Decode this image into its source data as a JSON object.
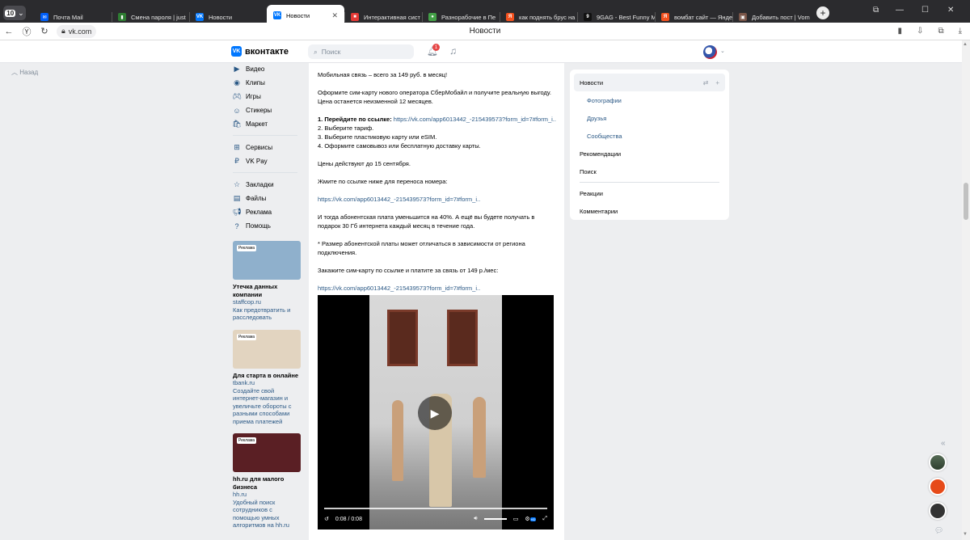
{
  "browser": {
    "tab_count": "10",
    "tabs": [
      {
        "label": "Почта Mail",
        "color": "#005ff9",
        "glyph": "✉"
      },
      {
        "label": "Смена пароля | just",
        "color": "#2e7d32",
        "glyph": "▮"
      },
      {
        "label": "Новости",
        "color": "#0077ff",
        "glyph": "VK"
      },
      {
        "label": "Новости",
        "color": "#0077ff",
        "glyph": "VK",
        "active": true
      },
      {
        "label": "Интерактивная сист",
        "color": "#e53935",
        "glyph": "■"
      },
      {
        "label": "Разнорабочие в Пе",
        "color": "#43a047",
        "glyph": "●"
      },
      {
        "label": "как поднять брус на",
        "color": "#f4511e",
        "glyph": "Я"
      },
      {
        "label": "9GAG - Best Funny M",
        "color": "#111111",
        "glyph": "9"
      },
      {
        "label": "вомбат сайт — Янде",
        "color": "#f4511e",
        "glyph": "Я"
      },
      {
        "label": "Добавить пост | Vom",
        "color": "#795548",
        "glyph": "▣"
      }
    ],
    "url": "vk.com",
    "page_title": "Новости"
  },
  "vk": {
    "brand": "вконтакте",
    "search_placeholder": "Поиск",
    "notif_count": "1",
    "back": "Назад"
  },
  "left_menu": {
    "group1": [
      "Видео",
      "Клипы",
      "Игры",
      "Стикеры",
      "Маркет"
    ],
    "group2": [
      "Сервисы",
      "VK Pay"
    ],
    "group3": [
      "Закладки",
      "Файлы",
      "Реклама",
      "Помощь"
    ]
  },
  "ads": [
    {
      "tag": "Реклама",
      "title": "Утечка данных компании",
      "domain": "staffcop.ru",
      "desc": "Как предотвратить и расследовать",
      "bg": "#8fb0cc"
    },
    {
      "tag": "Реклама",
      "title": "Для старта в онлайне",
      "domain": "tbank.ru",
      "desc": "Создайте свой интернет-магазин и увеличьте обороты с разными способами приема платежей",
      "bg": "#e2d4c0"
    },
    {
      "tag": "Реклама",
      "title": "hh.ru для малого бизнеса",
      "domain": "hh.ru",
      "desc": "Удобный поиск сотрудников с помощью умных алгоритмов на hh.ru",
      "bg": "#5a1f24"
    }
  ],
  "post": {
    "p1": "Мобильная связь – всего за 149 руб. в месяц!",
    "p2a": "Оформите сим-карту нового оператора СберМобайл и получите реальную выгоду.",
    "p2b": "Цена останется неизменной 12 месяцев.",
    "step1_prefix": "1. Перейдите по ссылке: ",
    "step1_link": "https://vk.com/app6013442_-215439573?form_id=7#form_i..",
    "step2": "2. Выберите тариф.",
    "step3": "3. Выберите пластиковую карту или eSIM.",
    "step4": "4. Оформите самовывоз или бесплатную доставку карты.",
    "deadline": "Цены действуют до 15 сентября.",
    "transfer": "Жмите по ссылке ниже для переноса номера:",
    "link2": "https://vk.com/app6013442_-215439573?form_id=7#form_i..",
    "p5a": "И тогда абонентская плата уменьшится на 40%. А ещё вы будете получать в",
    "p5b": "подарок 30 Гб интернета каждый месяц в течение года.",
    "note_a": "* Размер абонентской платы может отличаться в зависимости от региона",
    "note_b": "подключения.",
    "order": "Закажите сим-карту по ссылке и платите за связь от 149 р./мес:",
    "link3": "https://vk.com/app6013442_-215439573?form_id=7#form_i..",
    "video_time": "0:08 / 0:08",
    "video_quality": "HD"
  },
  "right_panel": {
    "news": "Новости",
    "subs": [
      "Фотографии",
      "Друзья",
      "Сообщества"
    ],
    "items": [
      "Рекомендации",
      "Поиск"
    ],
    "items2": [
      "Реакции",
      "Комментарии"
    ]
  }
}
